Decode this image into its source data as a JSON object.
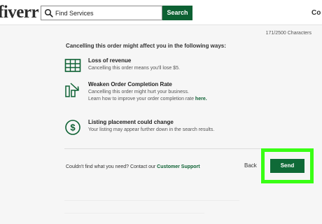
{
  "header": {
    "logo": "fiverr",
    "search_placeholder": "Find Services",
    "search_button": "Search",
    "right_edge_text": "Co"
  },
  "editor": {
    "char_count": "171/2500 Characters"
  },
  "impact": {
    "title": "Cancelling this order might affect you in the following ways:",
    "items": [
      {
        "icon": "revenue-table-icon",
        "title": "Loss of revenue",
        "desc": "Cancelling this order means you'll lose $5."
      },
      {
        "icon": "completion-chart-icon",
        "title": "Weaken Order Completion Rate",
        "desc": "Cancelling this order might hurt your business.",
        "desc2_prefix": "Learn how to improve your order completion rate ",
        "desc2_link": "here."
      },
      {
        "icon": "dollar-circle-icon",
        "title": "Listing placement could change",
        "desc": "Your listing may appear further down in the search results."
      }
    ]
  },
  "footer": {
    "support_prefix": "Couldn't find what you need? Contact our ",
    "support_link": "Customer Support",
    "back_label": "Back",
    "send_label": "Send"
  },
  "colors": {
    "brand_green": "#0d6133",
    "highlight": "#39ff14"
  }
}
